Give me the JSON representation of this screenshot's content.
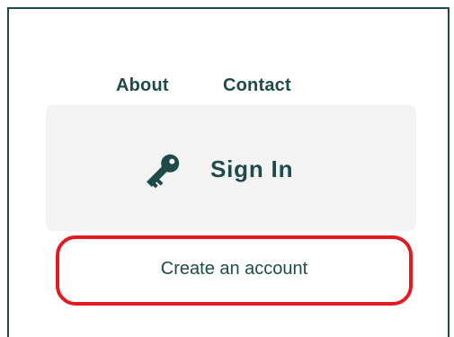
{
  "nav": {
    "items": [
      {
        "label": "About"
      },
      {
        "label": "Contact"
      }
    ]
  },
  "signin": {
    "label": "Sign In",
    "icon": "key-icon"
  },
  "account": {
    "create_label": "Create an account"
  },
  "colors": {
    "text": "#1e4a4a",
    "panel_border": "#1e4a4a",
    "signin_bg": "#f3f3f3",
    "highlight": "#e21b23",
    "background": "#ffffff"
  }
}
